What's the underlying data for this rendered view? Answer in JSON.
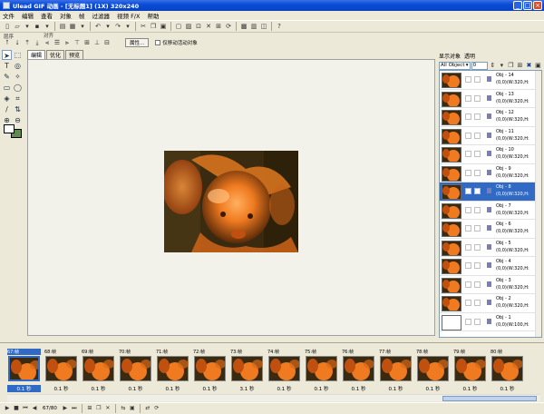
{
  "titlebar": {
    "title": "Ulead GIF 动画 - [无标题1] (1X)  320x240",
    "minimize": "_",
    "maximize": "□",
    "close": "×"
  },
  "menu": [
    "文件",
    "编辑",
    "查看",
    "对象",
    "帧",
    "过滤器",
    "视频 F/X",
    "帮助"
  ],
  "toolbar2": {
    "arrange_label": "层序",
    "align_label": "对齐",
    "properties_button": "属性...",
    "move_selected_checkbox": "仅移动活动对象"
  },
  "tabs": [
    "编辑",
    "优化",
    "预览"
  ],
  "objects_panel": {
    "show_label": "显示对象",
    "opacity_label": "透明",
    "filter_value": "All Object",
    "opacity_value": "0",
    "rows": [
      {
        "name": "Obj - 14",
        "info": "(0,0)(W:320,H:"
      },
      {
        "name": "Obj - 13",
        "info": "(0,0)(W:320,H:"
      },
      {
        "name": "Obj - 12",
        "info": "(0,0)(W:320,H:"
      },
      {
        "name": "Obj - 11",
        "info": "(0,0)(W:320,H:"
      },
      {
        "name": "Obj - 10",
        "info": "(0,0)(W:320,H:"
      },
      {
        "name": "Obj - 9",
        "info": "(0,0)(W:320,H:"
      },
      {
        "name": "Obj - 8",
        "info": "(0,0)(W:320,H:",
        "selected": true
      },
      {
        "name": "Obj - 7",
        "info": "(0,0)(W:320,H:"
      },
      {
        "name": "Obj - 6",
        "info": "(0,0)(W:320,H:"
      },
      {
        "name": "Obj - 5",
        "info": "(0,0)(W:320,H:"
      },
      {
        "name": "Obj - 4",
        "info": "(0,0)(W:320,H:"
      },
      {
        "name": "Obj - 3",
        "info": "(0,0)(W:320,H:"
      },
      {
        "name": "Obj - 2",
        "info": "(0,0)(W:320,H:"
      },
      {
        "name": "Obj - 1",
        "info": "(0,0)(W:100,H:",
        "blank": true
      }
    ]
  },
  "frames": [
    {
      "label": "67:帧",
      "delay": "0.1 秒",
      "selected": true
    },
    {
      "label": "68:帧",
      "delay": "0.1 秒"
    },
    {
      "label": "69:帧",
      "delay": "0.1 秒"
    },
    {
      "label": "70:帧",
      "delay": "0.1 秒"
    },
    {
      "label": "71:帧",
      "delay": "0.1 秒"
    },
    {
      "label": "72:帧",
      "delay": "0.1 秒"
    },
    {
      "label": "73:帧",
      "delay": "3.1 秒"
    },
    {
      "label": "74:帧",
      "delay": "0.1 秒"
    },
    {
      "label": "75:帧",
      "delay": "0.1 秒"
    },
    {
      "label": "76:帧",
      "delay": "0.1 秒"
    },
    {
      "label": "77:帧",
      "delay": "0.1 秒"
    },
    {
      "label": "78:帧",
      "delay": "0.1 秒"
    },
    {
      "label": "79:帧",
      "delay": "0.1 秒"
    },
    {
      "label": "80:帧",
      "delay": "0.1 秒"
    }
  ],
  "playback": {
    "frame_counter": "67/80"
  },
  "colors": {
    "selection": "#316ac5",
    "titlebar": "#0a4dd8",
    "background": "#ece9d8"
  }
}
